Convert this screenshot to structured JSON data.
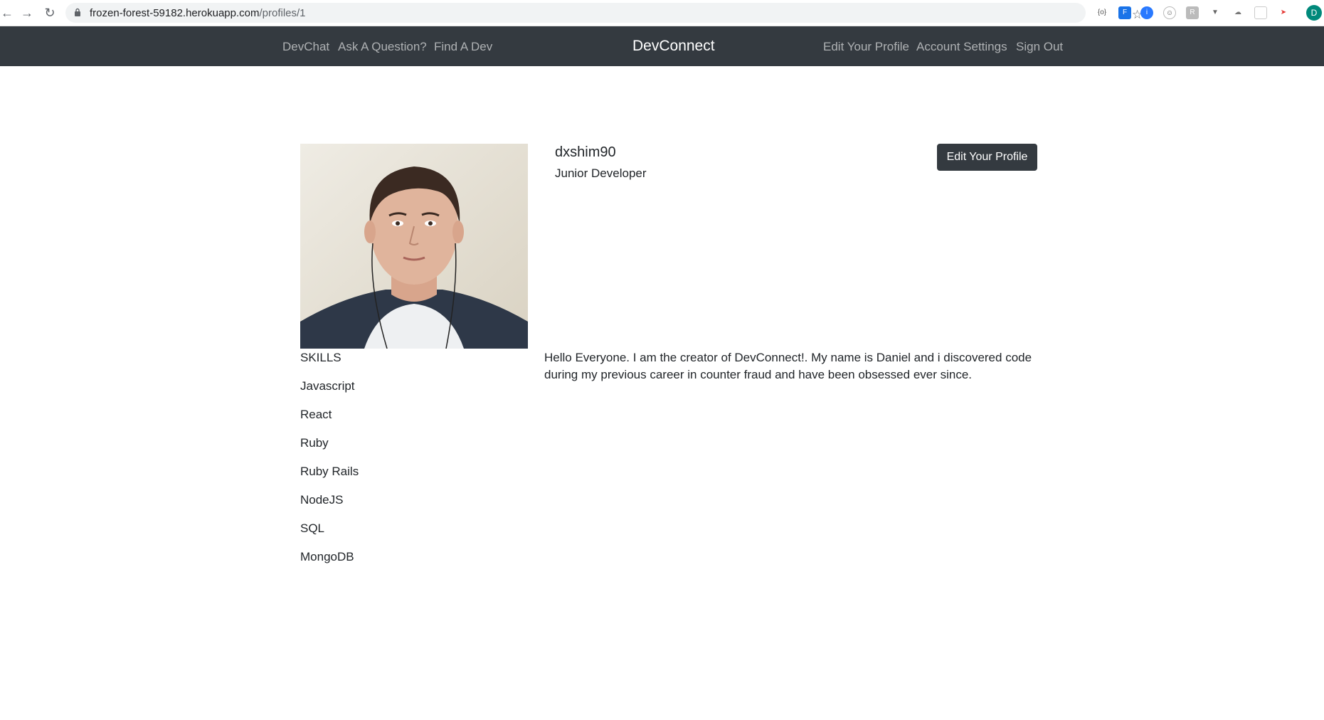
{
  "browser": {
    "url_host": "frozen-forest-59182.herokuapp.com",
    "url_path": "/profiles/1",
    "profile_initial": "D"
  },
  "navbar": {
    "left_links": [
      "DevChat",
      "Ask A Question?",
      "Find A Dev"
    ],
    "brand": "DevConnect",
    "right_links": [
      "Edit Your Profile",
      "Account Settings",
      "Sign Out"
    ]
  },
  "profile": {
    "username": "dxshim90",
    "status": "Junior Developer",
    "edit_button": "Edit Your Profile",
    "bio": "Hello Everyone. I am the creator of DevConnect!. My name is Daniel and i discovered code during my previous career in counter fraud and have been obsessed ever since.",
    "skills_title": "SKILLS",
    "skills": [
      "Javascript",
      "React",
      "Ruby",
      "Ruby Rails",
      "NodeJS",
      "SQL",
      "MongoDB"
    ]
  },
  "colors": {
    "navbar_bg": "#343a40",
    "button_bg": "#343a40",
    "nav_link": "rgba(255,255,255,0.6)",
    "brand": "#ffffff"
  }
}
